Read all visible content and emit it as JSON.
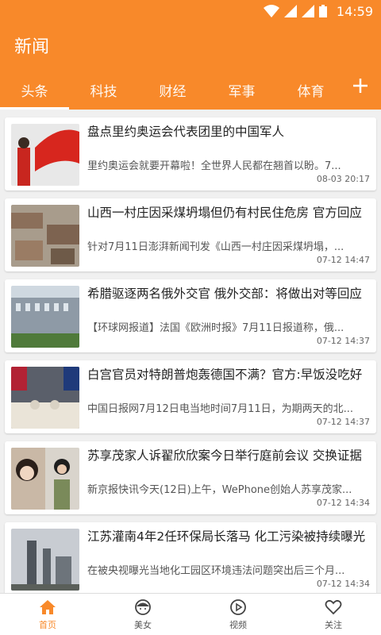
{
  "status": {
    "time": "14:59"
  },
  "app": {
    "title": "新闻"
  },
  "tabs": [
    {
      "label": "头条"
    },
    {
      "label": "科技"
    },
    {
      "label": "财经"
    },
    {
      "label": "军事"
    },
    {
      "label": "体育"
    }
  ],
  "news": [
    {
      "title": "盘点里约奥运会代表团里的中国军人",
      "summary": "里约奥运会就要开幕啦！全世界人民都在翘首以盼。7...",
      "date": "08-03 20:17",
      "thumb": "flag"
    },
    {
      "title": "山西一村庄因采煤坍塌但仍有村民住危房 官方回应",
      "summary": "针对7月11日澎湃新闻刊发《山西一村庄因采煤坍塌，...",
      "date": "07-12 14:47",
      "thumb": "village"
    },
    {
      "title": "希腊驱逐两名俄外交官 俄外交部：将做出对等回应",
      "summary": "【环球网报道】法国《欧洲时报》7月11日报道称，俄...",
      "date": "07-12 14:37",
      "thumb": "building"
    },
    {
      "title": "白宫官员对特朗普炮轰德国不满？官方:早饭没吃好",
      "summary": "中国日报网7月12日电当地时间7月11日，为期两天的北...",
      "date": "07-12 14:37",
      "thumb": "meeting"
    },
    {
      "title": "苏享茂家人诉翟欣欣案今日举行庭前会议 交换证据",
      "summary": "新京报快讯今天(12日)上午，WePhone创始人苏享茂家...",
      "date": "07-12 14:34",
      "thumb": "people"
    },
    {
      "title": "江苏灌南4年2任环保局长落马 化工污染被持续曝光",
      "summary": "在被央视曝光当地化工园区环境违法问题突出后三个月...",
      "date": "07-12 14:34",
      "thumb": "factory"
    }
  ],
  "bottom_nav": [
    {
      "label": "首页",
      "icon": "home-icon"
    },
    {
      "label": "美女",
      "icon": "girl-icon"
    },
    {
      "label": "视频",
      "icon": "video-icon"
    },
    {
      "label": "关注",
      "icon": "heart-icon"
    }
  ],
  "colors": {
    "accent": "#f8892a"
  }
}
